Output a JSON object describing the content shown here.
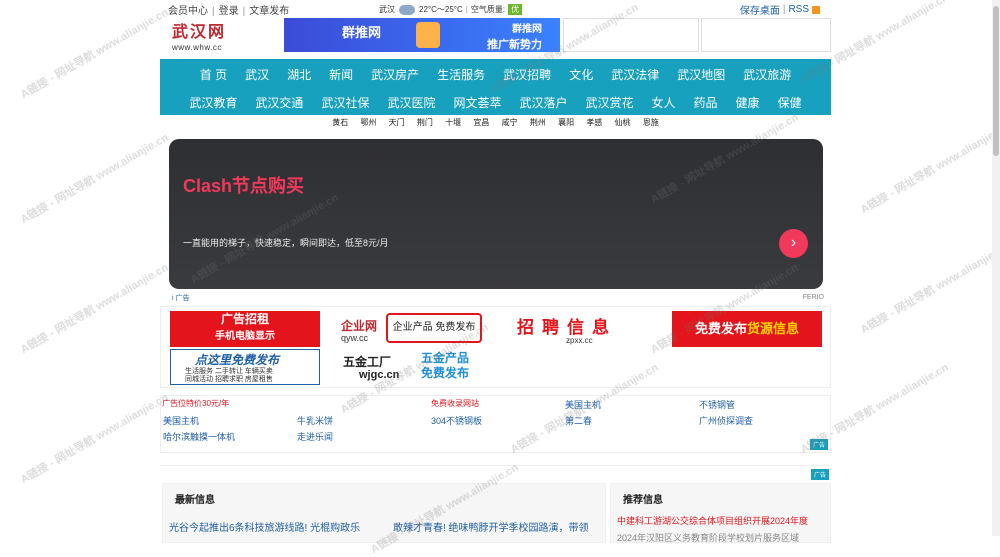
{
  "topbar": {
    "member": "会员中心",
    "login": "登录",
    "post": "文章发布",
    "weather_city": "武汉",
    "weather_temp": "22°C～25°C",
    "air_label": "空气质量:",
    "air_value": "优",
    "save_desktop": "保存桌面",
    "rss": "RSS"
  },
  "logo": {
    "title": "武汉网",
    "sub": "www.whw.cc"
  },
  "banner": {
    "name": "群推网",
    "line1": "群推网",
    "line2": "推广新势力"
  },
  "nav": {
    "row1": [
      "首 页",
      "武汉",
      "湖北",
      "新闻",
      "武汉房产",
      "生活服务",
      "武汉招聘",
      "文化",
      "武汉法律",
      "武汉地图",
      "武汉旅游"
    ],
    "row2": [
      "武汉教育",
      "武汉交通",
      "武汉社保",
      "武汉医院",
      "网文荟萃",
      "武汉落户",
      "武汉赏花",
      "女人",
      "药品",
      "健康",
      "保健"
    ]
  },
  "cities": [
    "黄石",
    "鄂州",
    "天门",
    "荆门",
    "十堰",
    "宜昌",
    "咸宁",
    "荆州",
    "襄阳",
    "孝感",
    "仙桃",
    "恩施"
  ],
  "bigad": {
    "title": "Clash节点购买",
    "desc": "一直能用的梯子，快速稳定，瞬间即达，低至8元/月",
    "go": "›",
    "info": "i 广告",
    "brand": "FERIO"
  },
  "ads": {
    "ad1_l1": "广告招租",
    "ad1_l2": "手机电脑显示",
    "ad2_brand": "企业网",
    "ad2_domain": "qyw.cc",
    "ad2_box": "企业产品 免费发布",
    "ad3_title": "招聘信息",
    "ad3_domain": "zpxx.cc",
    "ad4_text_a": "免费发布",
    "ad4_text_b": "货源信息",
    "ad5_title": "点这里免费发布",
    "ad5_l1": "生活服务  二手转让  车辆买卖",
    "ad5_l2": "同城活动  招聘求职  房屋租售",
    "ad6_name": "五金工厂",
    "ad6_domain": "wjgc.cn",
    "ad6_l1": "五金产品",
    "ad6_l2": "免费发布"
  },
  "links": {
    "r1": [
      "广告位特价30元/年",
      "免费收录网站",
      "美国主机",
      "不锈钢管"
    ],
    "r2": [
      "美国主机",
      "牛乳米饼",
      "304不锈钢板",
      "第二春",
      "广州侦探调查"
    ],
    "r3": [
      "哈尔滨触摸一体机",
      "走进乐闻"
    ],
    "ad_label": "广告"
  },
  "panels": {
    "latest": "最新信息",
    "latest_items": [
      "光谷今起推出6条科技旅游线路! 光棍购政乐",
      "敢辣才青春! 绝味鸭脖开学季校园路演，带领"
    ],
    "recommend": "推荐信息",
    "rec_items": [
      "中建科工游湖公交综合体项目组织开展2024年度",
      "2024年汉阳区义务教育阶段学校划片服务区域"
    ]
  },
  "watermark": "A链接 - 网址导航 www.alianjie.cn",
  "colors": {
    "nav": "#17a1be",
    "red": "#e3141b",
    "link": "#1f5fa8"
  }
}
